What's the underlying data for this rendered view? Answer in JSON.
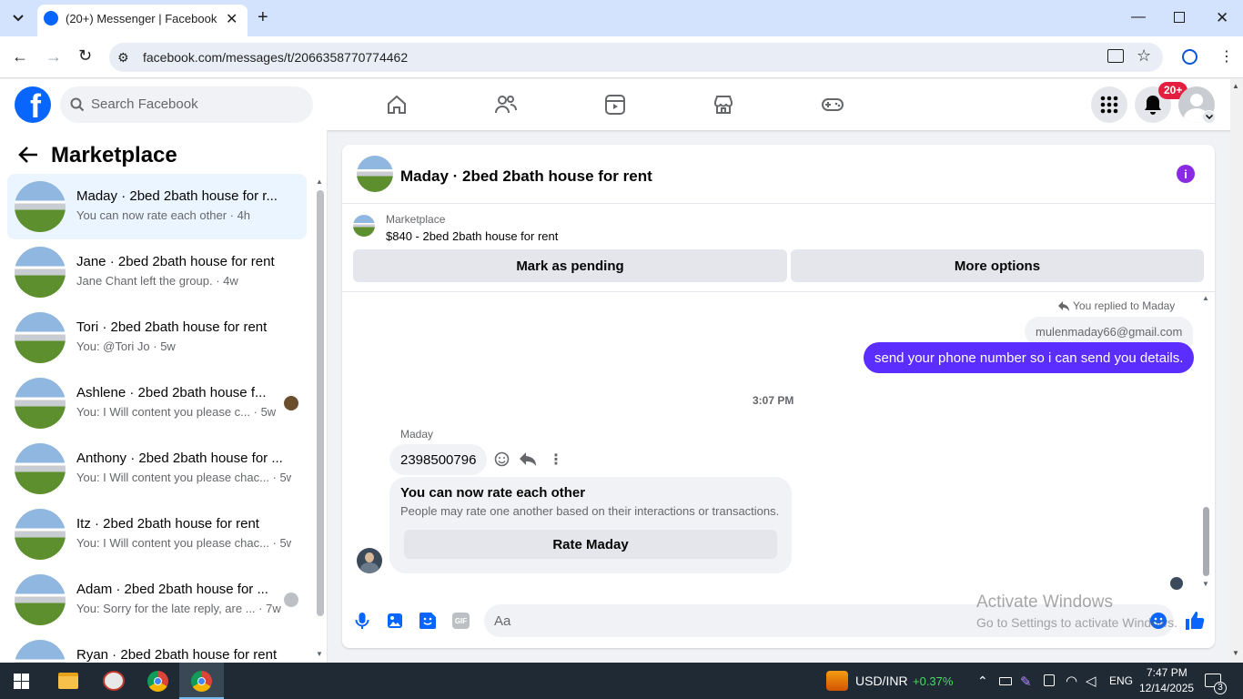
{
  "browser": {
    "tab_title": "(20+) Messenger | Facebook",
    "url": "facebook.com/messages/t/2066358770774462"
  },
  "header": {
    "search_placeholder": "Search Facebook",
    "notification_badge": "20+",
    "brand_color": "#0866ff"
  },
  "sidebar": {
    "title": "Marketplace",
    "conversations": [
      {
        "name": "Maday · 2bed 2bath house for r...",
        "preview": "You can now rate each other · 4h",
        "selected": true
      },
      {
        "name": "Jane · 2bed 2bath house for rent",
        "preview": "Jane Chant left the group. · 4w"
      },
      {
        "name": "Tori · 2bed 2bath house for rent",
        "preview": "You: @Tori Jo · 5w"
      },
      {
        "name": "Ashlene · 2bed 2bath house f...",
        "preview": "You: I Will content you please c... · 5w"
      },
      {
        "name": "Anthony · 2bed 2bath house for ...",
        "preview": "You: I Will content you please chac... · 5w"
      },
      {
        "name": "Itz · 2bed 2bath house for rent",
        "preview": "You: I Will content you please chac... · 5w"
      },
      {
        "name": "Adam · 2bed 2bath house for ...",
        "preview": "You: Sorry for the late reply, are ... · 7w"
      },
      {
        "name": "Ryan · 2bed 2bath house for rent",
        "preview": ""
      }
    ]
  },
  "chat": {
    "title": "Maday · 2bed 2bath house for rent",
    "listing_label": "Marketplace",
    "listing_title": "$840 - 2bed 2bath house for rent",
    "mark_pending": "Mark as pending",
    "more_options": "More options",
    "replied_to": "You replied to Maday",
    "quoted_email": "mulenmaday66@gmail.com",
    "my_message": "send your phone number so i can send you details.",
    "timestamp": "3:07 PM",
    "sender_name": "Maday",
    "their_message": "2398500796",
    "rate_title": "You can now rate each other",
    "rate_desc": "People may rate one another based on their interactions or transactions.",
    "rate_button": "Rate Maday",
    "composer_placeholder": "Aa",
    "accent_color": "#5b2dff"
  },
  "watermark": {
    "line1": "Activate Windows",
    "line2": "Go to Settings to activate Windows."
  },
  "taskbar": {
    "ticker": "USD/INR",
    "ticker_change": "+0.37%",
    "lang": "ENG",
    "time": "7:47 PM",
    "date": "12/14/2025",
    "notif_count": "3"
  }
}
